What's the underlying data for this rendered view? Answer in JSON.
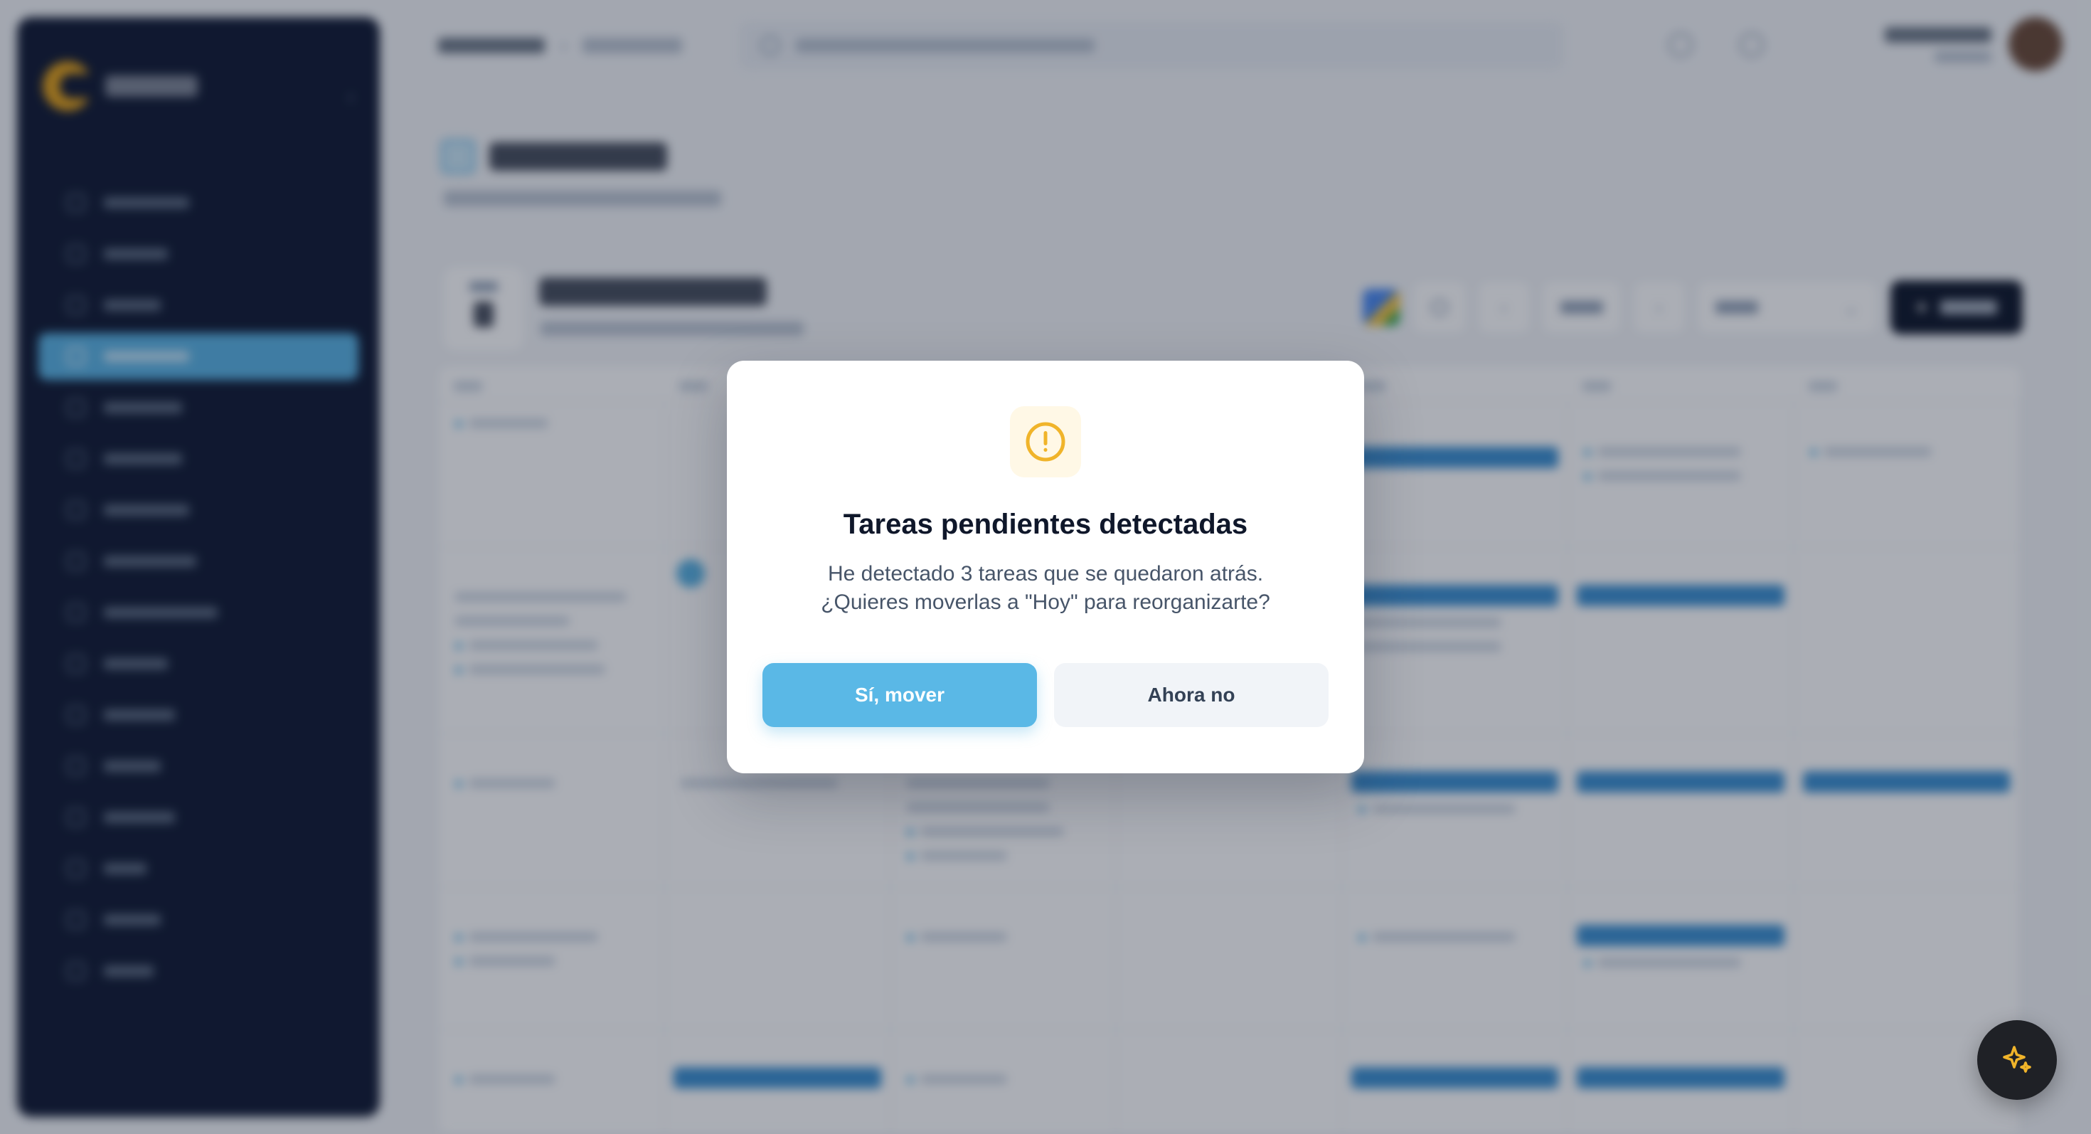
{
  "modal": {
    "title": "Tareas pendientes detectadas",
    "message_line1": "He detectado 3 tareas que se quedaron atrás.",
    "message_line2": "¿Quieres moverlas a \"Hoy\" para reorganizarte?",
    "confirm_label": "Sí, mover",
    "dismiss_label": "Ahora no",
    "icon": "alert-circle-icon",
    "accent_color": "#f0b42a",
    "primary_color": "#5ab8e6"
  },
  "fab": {
    "icon": "sparkles-icon",
    "color": "#f0b42a"
  }
}
